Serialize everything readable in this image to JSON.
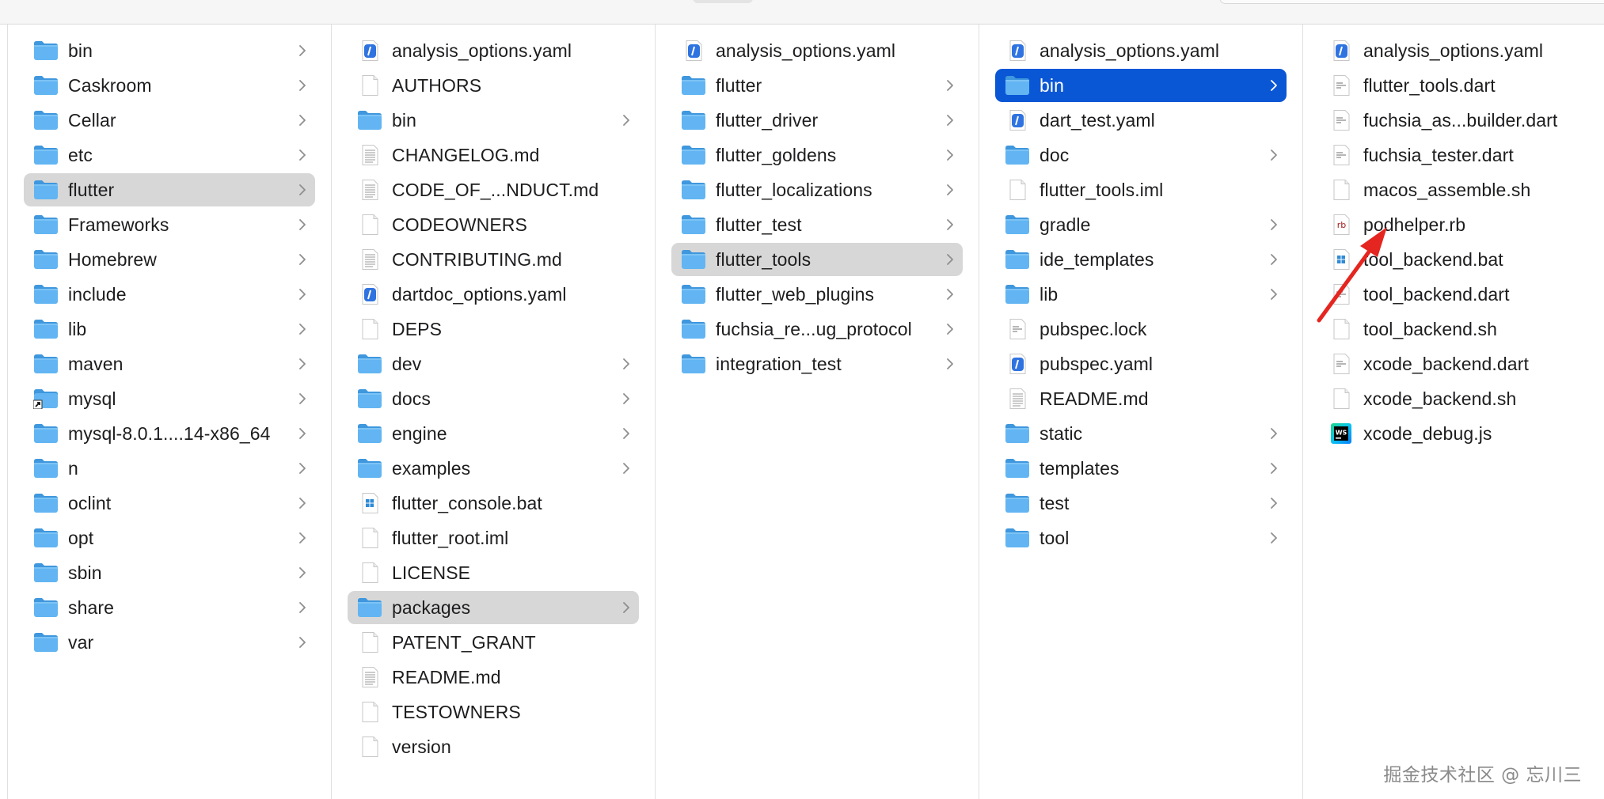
{
  "columns": [
    {
      "items": [
        {
          "label": "bin",
          "icon": "folder-icon",
          "chevron": true,
          "state": ""
        },
        {
          "label": "Caskroom",
          "icon": "folder-icon",
          "chevron": true,
          "state": ""
        },
        {
          "label": "Cellar",
          "icon": "folder-icon",
          "chevron": true,
          "state": ""
        },
        {
          "label": "etc",
          "icon": "folder-icon",
          "chevron": true,
          "state": ""
        },
        {
          "label": "flutter",
          "icon": "folder-icon",
          "chevron": true,
          "state": "path"
        },
        {
          "label": "Frameworks",
          "icon": "folder-icon",
          "chevron": true,
          "state": ""
        },
        {
          "label": "Homebrew",
          "icon": "folder-icon",
          "chevron": true,
          "state": ""
        },
        {
          "label": "include",
          "icon": "folder-icon",
          "chevron": true,
          "state": ""
        },
        {
          "label": "lib",
          "icon": "folder-icon",
          "chevron": true,
          "state": ""
        },
        {
          "label": "maven",
          "icon": "folder-icon",
          "chevron": true,
          "state": ""
        },
        {
          "label": "mysql",
          "icon": "folder-alias-icon",
          "chevron": true,
          "state": ""
        },
        {
          "label": "mysql-8.0.1....14-x86_64",
          "icon": "folder-icon",
          "chevron": true,
          "state": ""
        },
        {
          "label": "n",
          "icon": "folder-icon",
          "chevron": true,
          "state": ""
        },
        {
          "label": "oclint",
          "icon": "folder-icon",
          "chevron": true,
          "state": ""
        },
        {
          "label": "opt",
          "icon": "folder-icon",
          "chevron": true,
          "state": ""
        },
        {
          "label": "sbin",
          "icon": "folder-icon",
          "chevron": true,
          "state": ""
        },
        {
          "label": "share",
          "icon": "folder-icon",
          "chevron": true,
          "state": ""
        },
        {
          "label": "var",
          "icon": "folder-icon",
          "chevron": true,
          "state": ""
        }
      ]
    },
    {
      "items": [
        {
          "label": "analysis_options.yaml",
          "icon": "yaml-file-icon",
          "chevron": false,
          "state": ""
        },
        {
          "label": "AUTHORS",
          "icon": "blank-file-icon",
          "chevron": false,
          "state": ""
        },
        {
          "label": "bin",
          "icon": "folder-icon",
          "chevron": true,
          "state": ""
        },
        {
          "label": "CHANGELOG.md",
          "icon": "text-file-icon",
          "chevron": false,
          "state": ""
        },
        {
          "label": "CODE_OF_...NDUCT.md",
          "icon": "text-file-icon",
          "chevron": false,
          "state": ""
        },
        {
          "label": "CODEOWNERS",
          "icon": "blank-file-icon",
          "chevron": false,
          "state": ""
        },
        {
          "label": "CONTRIBUTING.md",
          "icon": "text-file-icon",
          "chevron": false,
          "state": ""
        },
        {
          "label": "dartdoc_options.yaml",
          "icon": "yaml-file-icon",
          "chevron": false,
          "state": ""
        },
        {
          "label": "DEPS",
          "icon": "blank-file-icon",
          "chevron": false,
          "state": ""
        },
        {
          "label": "dev",
          "icon": "folder-icon",
          "chevron": true,
          "state": ""
        },
        {
          "label": "docs",
          "icon": "folder-icon",
          "chevron": true,
          "state": ""
        },
        {
          "label": "engine",
          "icon": "folder-icon",
          "chevron": true,
          "state": ""
        },
        {
          "label": "examples",
          "icon": "folder-icon",
          "chevron": true,
          "state": ""
        },
        {
          "label": "flutter_console.bat",
          "icon": "bat-file-icon",
          "chevron": false,
          "state": ""
        },
        {
          "label": "flutter_root.iml",
          "icon": "blank-file-icon",
          "chevron": false,
          "state": ""
        },
        {
          "label": "LICENSE",
          "icon": "blank-file-icon",
          "chevron": false,
          "state": ""
        },
        {
          "label": "packages",
          "icon": "folder-icon",
          "chevron": true,
          "state": "path"
        },
        {
          "label": "PATENT_GRANT",
          "icon": "blank-file-icon",
          "chevron": false,
          "state": ""
        },
        {
          "label": "README.md",
          "icon": "text-file-icon",
          "chevron": false,
          "state": ""
        },
        {
          "label": "TESTOWNERS",
          "icon": "blank-file-icon",
          "chevron": false,
          "state": ""
        },
        {
          "label": "version",
          "icon": "blank-file-icon",
          "chevron": false,
          "state": ""
        }
      ]
    },
    {
      "items": [
        {
          "label": "analysis_options.yaml",
          "icon": "yaml-file-icon",
          "chevron": false,
          "state": ""
        },
        {
          "label": "flutter",
          "icon": "folder-icon",
          "chevron": true,
          "state": ""
        },
        {
          "label": "flutter_driver",
          "icon": "folder-icon",
          "chevron": true,
          "state": ""
        },
        {
          "label": "flutter_goldens",
          "icon": "folder-icon",
          "chevron": true,
          "state": ""
        },
        {
          "label": "flutter_localizations",
          "icon": "folder-icon",
          "chevron": true,
          "state": ""
        },
        {
          "label": "flutter_test",
          "icon": "folder-icon",
          "chevron": true,
          "state": ""
        },
        {
          "label": "flutter_tools",
          "icon": "folder-icon",
          "chevron": true,
          "state": "path"
        },
        {
          "label": "flutter_web_plugins",
          "icon": "folder-icon",
          "chevron": true,
          "state": ""
        },
        {
          "label": "fuchsia_re...ug_protocol",
          "icon": "folder-icon",
          "chevron": true,
          "state": ""
        },
        {
          "label": "integration_test",
          "icon": "folder-icon",
          "chevron": true,
          "state": ""
        }
      ]
    },
    {
      "items": [
        {
          "label": "analysis_options.yaml",
          "icon": "yaml-file-icon",
          "chevron": false,
          "state": ""
        },
        {
          "label": "bin",
          "icon": "folder-icon",
          "chevron": true,
          "state": "selected"
        },
        {
          "label": "dart_test.yaml",
          "icon": "yaml-file-icon",
          "chevron": false,
          "state": ""
        },
        {
          "label": "doc",
          "icon": "folder-icon",
          "chevron": true,
          "state": ""
        },
        {
          "label": "flutter_tools.iml",
          "icon": "blank-file-icon",
          "chevron": false,
          "state": ""
        },
        {
          "label": "gradle",
          "icon": "folder-icon",
          "chevron": true,
          "state": ""
        },
        {
          "label": "ide_templates",
          "icon": "folder-icon",
          "chevron": true,
          "state": ""
        },
        {
          "label": "lib",
          "icon": "folder-icon",
          "chevron": true,
          "state": ""
        },
        {
          "label": "pubspec.lock",
          "icon": "lines-file-icon",
          "chevron": false,
          "state": ""
        },
        {
          "label": "pubspec.yaml",
          "icon": "yaml-file-icon",
          "chevron": false,
          "state": ""
        },
        {
          "label": "README.md",
          "icon": "text-file-icon",
          "chevron": false,
          "state": ""
        },
        {
          "label": "static",
          "icon": "folder-icon",
          "chevron": true,
          "state": ""
        },
        {
          "label": "templates",
          "icon": "folder-icon",
          "chevron": true,
          "state": ""
        },
        {
          "label": "test",
          "icon": "folder-icon",
          "chevron": true,
          "state": ""
        },
        {
          "label": "tool",
          "icon": "folder-icon",
          "chevron": true,
          "state": ""
        }
      ]
    },
    {
      "items": [
        {
          "label": "analysis_options.yaml",
          "icon": "yaml-file-icon",
          "chevron": false,
          "state": ""
        },
        {
          "label": "flutter_tools.dart",
          "icon": "lines-file-icon",
          "chevron": false,
          "state": ""
        },
        {
          "label": "fuchsia_as...builder.dart",
          "icon": "lines-file-icon",
          "chevron": false,
          "state": ""
        },
        {
          "label": "fuchsia_tester.dart",
          "icon": "lines-file-icon",
          "chevron": false,
          "state": ""
        },
        {
          "label": "macos_assemble.sh",
          "icon": "blank-file-icon",
          "chevron": false,
          "state": ""
        },
        {
          "label": "podhelper.rb",
          "icon": "ruby-file-icon",
          "chevron": false,
          "state": ""
        },
        {
          "label": "tool_backend.bat",
          "icon": "bat-file-icon",
          "chevron": false,
          "state": ""
        },
        {
          "label": "tool_backend.dart",
          "icon": "lines-file-icon",
          "chevron": false,
          "state": ""
        },
        {
          "label": "tool_backend.sh",
          "icon": "blank-file-icon",
          "chevron": false,
          "state": ""
        },
        {
          "label": "xcode_backend.dart",
          "icon": "lines-file-icon",
          "chevron": false,
          "state": ""
        },
        {
          "label": "xcode_backend.sh",
          "icon": "blank-file-icon",
          "chevron": false,
          "state": ""
        },
        {
          "label": "xcode_debug.js",
          "icon": "webstorm-file-icon",
          "chevron": false,
          "state": ""
        }
      ]
    }
  ],
  "ruby_badge": "rb",
  "webstorm_badge": "WS",
  "watermark": "掘金技术社区 @ 忘川三",
  "colors": {
    "folder": "#5fb3f0",
    "selection": "#0a57d6",
    "path_highlight": "#d7d7d7",
    "arrow": "#e5251f"
  }
}
